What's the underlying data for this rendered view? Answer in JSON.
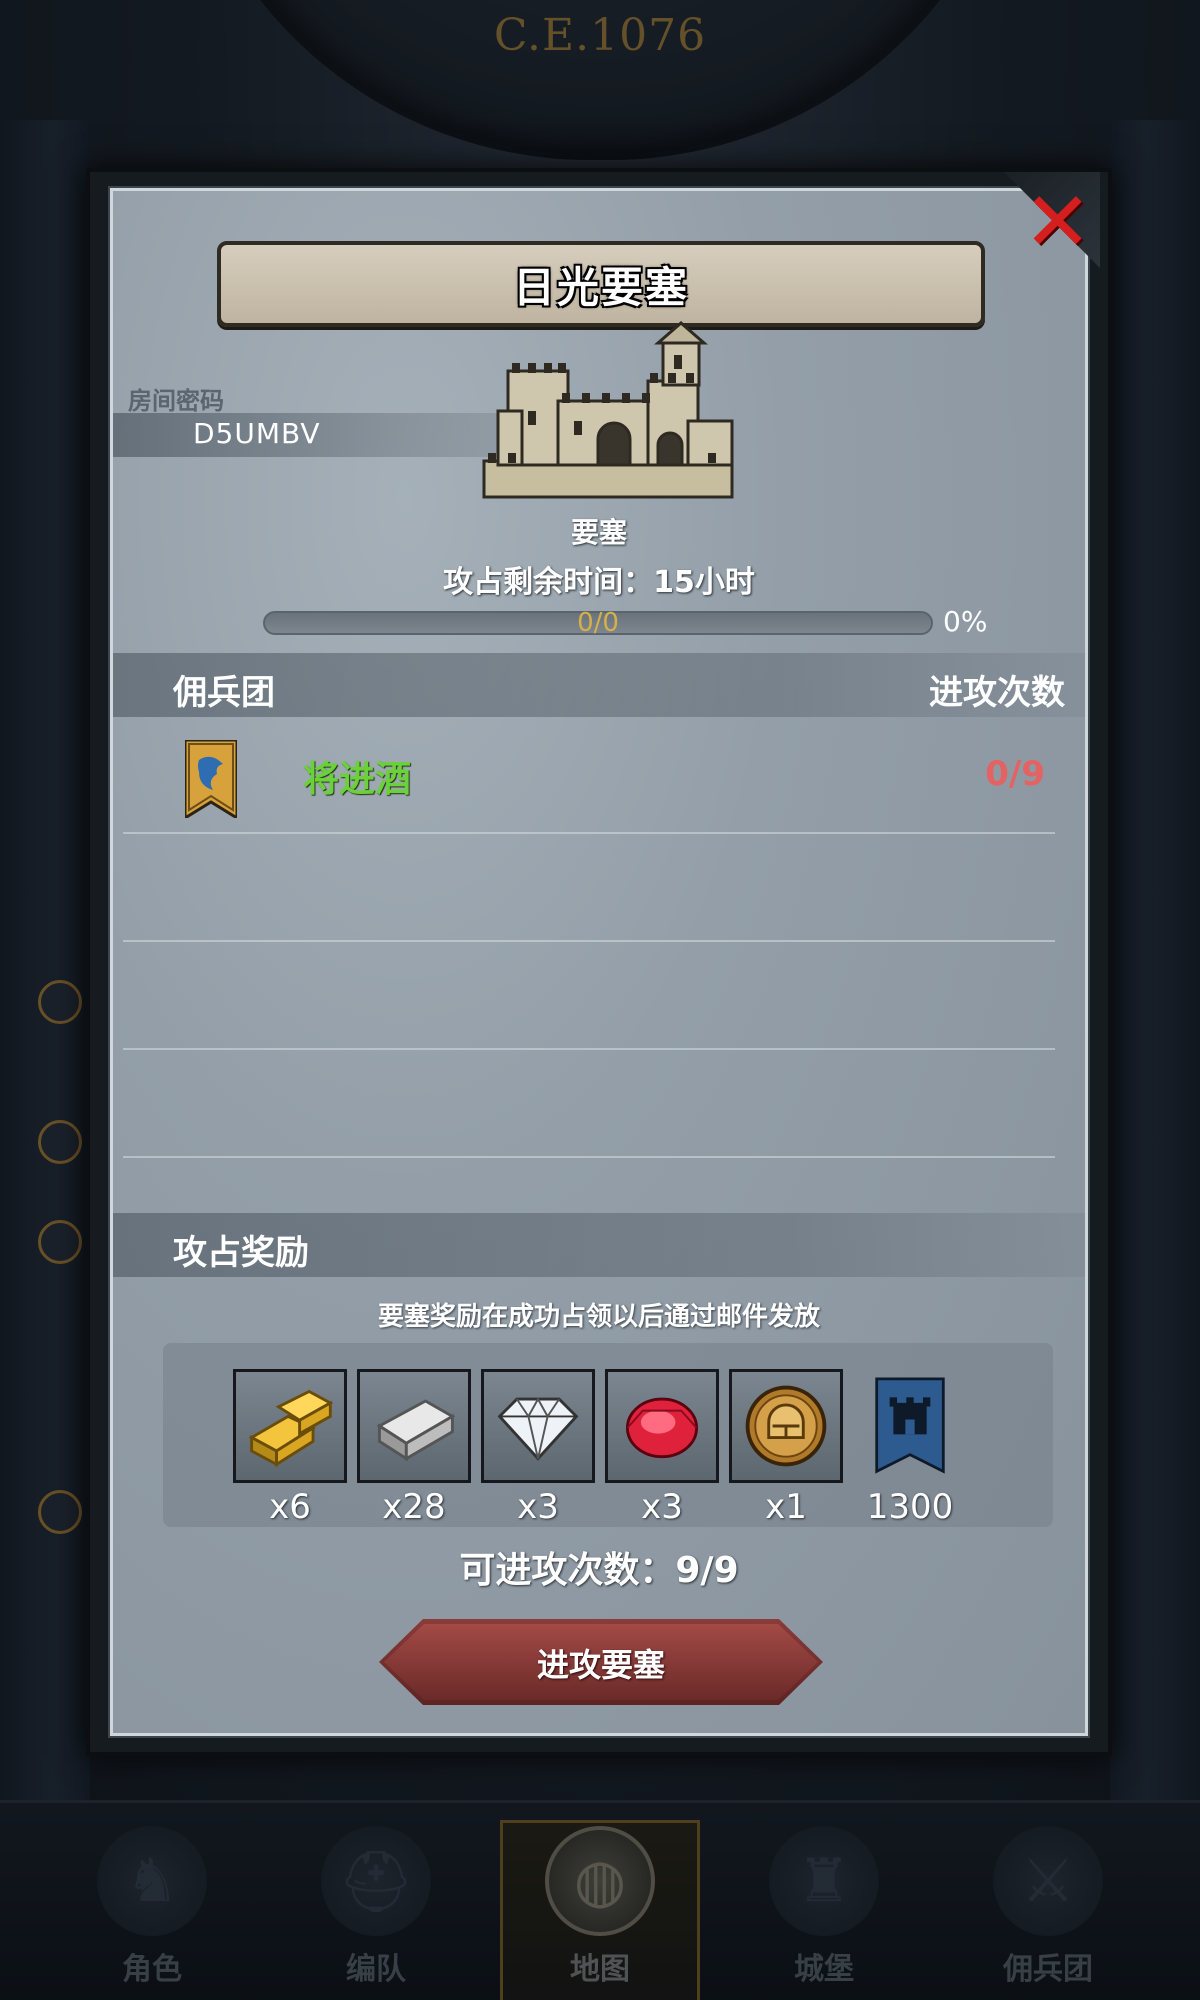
{
  "header": {
    "year": "C.E.1076"
  },
  "modal": {
    "title": "日光要塞",
    "room_code_label": "房间密码",
    "room_code": "D5UMBV",
    "fortress_type": "要塞",
    "remaining_time": "攻占剩余时间：15小时",
    "progress": {
      "text": "0/0",
      "percent_text": "0%",
      "fraction": 0
    },
    "guild_section": {
      "title": "佣兵团",
      "attacks_header": "进攻次数",
      "rows": [
        {
          "name": "将进酒",
          "attacks": "0/9",
          "banner_color": "#d7a23c"
        }
      ]
    },
    "reward_section": {
      "title": "攻占奖励",
      "note": "要塞奖励在成功占领以后通过邮件发放",
      "items": [
        {
          "icon": "gold-bar-icon",
          "count": "x6"
        },
        {
          "icon": "iron-bar-icon",
          "count": "x28"
        },
        {
          "icon": "diamond-icon",
          "count": "x3"
        },
        {
          "icon": "ruby-icon",
          "count": "x3"
        },
        {
          "icon": "knight-helmet-coin-icon",
          "count": "x1"
        },
        {
          "icon": "castle-banner-icon",
          "count": "1300"
        }
      ]
    },
    "attacks_available": "可进攻次数：9/9",
    "attack_button": "进攻要塞"
  },
  "bottom_nav": {
    "items": [
      {
        "label": "角色",
        "icon": "knight-icon"
      },
      {
        "label": "编队",
        "icon": "helmet-icon"
      },
      {
        "label": "地图",
        "icon": "globe-icon",
        "active": true
      },
      {
        "label": "城堡",
        "icon": "castle-icon"
      },
      {
        "label": "佣兵团",
        "icon": "mercenary-icon"
      }
    ]
  },
  "colors": {
    "guild_name": "#6bd13a",
    "attacks_count": "#e46262",
    "close_x": "#d51e1e",
    "progress": "#d4b04a"
  }
}
